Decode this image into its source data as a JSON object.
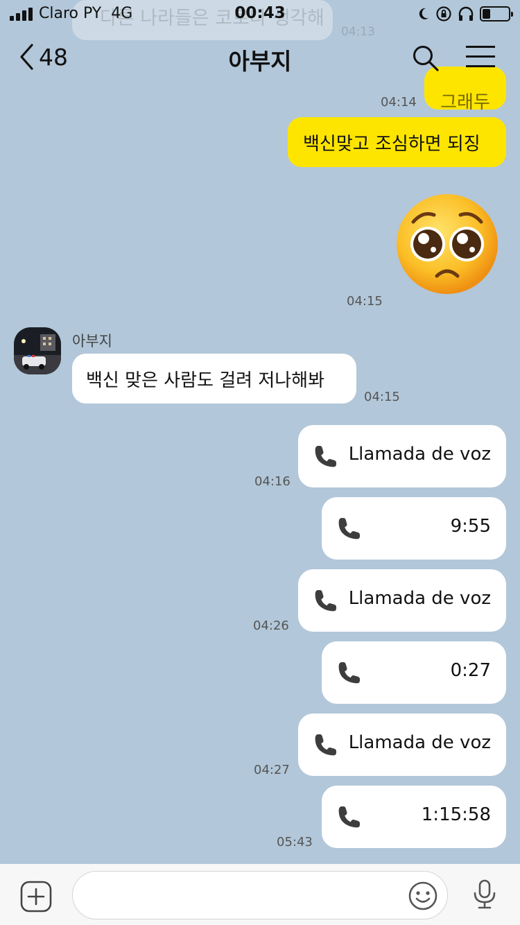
{
  "status_bar": {
    "carrier": "Claro PY",
    "network": "4G",
    "time": "00:43",
    "battery_level": 0.3,
    "icons": [
      "signal-icon",
      "moon-icon",
      "rotation-lock-icon",
      "headphones-icon",
      "battery-icon"
    ]
  },
  "header": {
    "back_count": "48",
    "title": "아부지",
    "icons": [
      "chevron-left-icon",
      "search-icon",
      "menu-icon"
    ]
  },
  "previous": {
    "text": "다른 나라들은 코로나 생각해",
    "time": "04:13",
    "partial_text": "그래두",
    "partial_time": "04:14"
  },
  "messages": [
    {
      "id": "m1",
      "from": "me",
      "text": "백신맞고 조심하면 되징",
      "time": "04:15"
    },
    {
      "id": "m2",
      "from": "me",
      "type": "emoji",
      "emoji": "pleading-face"
    },
    {
      "id": "m3",
      "from": "other",
      "sender": "아부지",
      "text": "백신 맞은 사람도 걸려 저나해봐",
      "time": "04:15"
    }
  ],
  "calls": [
    {
      "text": "Llamada de voz",
      "time": "04:16"
    },
    {
      "text": "9:55",
      "time": ""
    },
    {
      "text": "Llamada de voz",
      "time": "04:26"
    },
    {
      "text": "0:27",
      "time": ""
    },
    {
      "text": "Llamada de voz",
      "time": "04:27"
    },
    {
      "text": "1:15:58",
      "time": "05:43"
    }
  ],
  "input": {
    "placeholder": "",
    "value": ""
  },
  "colors": {
    "chat_bg": "#b2c7d9",
    "my_bubble": "#fee500",
    "other_bubble": "#ffffff",
    "input_bar": "#f7f7f7"
  }
}
